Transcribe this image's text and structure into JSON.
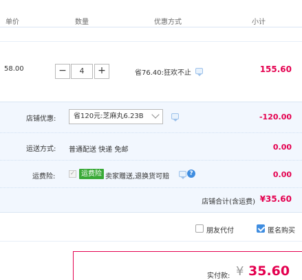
{
  "header": {
    "unit_price": "单价",
    "quantity": "数量",
    "discount": "优惠方式",
    "subtotal": "小计"
  },
  "item": {
    "unit_price": "58.00",
    "quantity": "4",
    "minus": "−",
    "plus": "+",
    "promotion": "省76.40:狂欢不止",
    "subtotal": "155.60"
  },
  "shop": {
    "coupon_label": "店铺优惠:",
    "coupon_selected": "省120元:芝麻丸6.23B",
    "coupon_value": "-120.00",
    "shipping_label": "运送方式:",
    "shipping_text": "普通配送 快递 免邮",
    "shipping_value": "0.00",
    "insurance_label": "运费险:",
    "insurance_check": "✓",
    "insurance_badge": "运费险",
    "insurance_text": "卖家赠送,退换货可赔",
    "insurance_value": "0.00",
    "total_label": "店铺合计(含运费)",
    "total_value": "¥35.60"
  },
  "options": {
    "friend_pay": "朋友代付",
    "anonymous": "匿名购买"
  },
  "payment": {
    "label": "实付款:",
    "currency": "¥",
    "amount": "35.60"
  },
  "colors": {
    "accent_red": "#e4004f",
    "accent_blue": "#3f8de0",
    "panel_bg": "#f2f7fe",
    "badge_green": "#39a936"
  }
}
